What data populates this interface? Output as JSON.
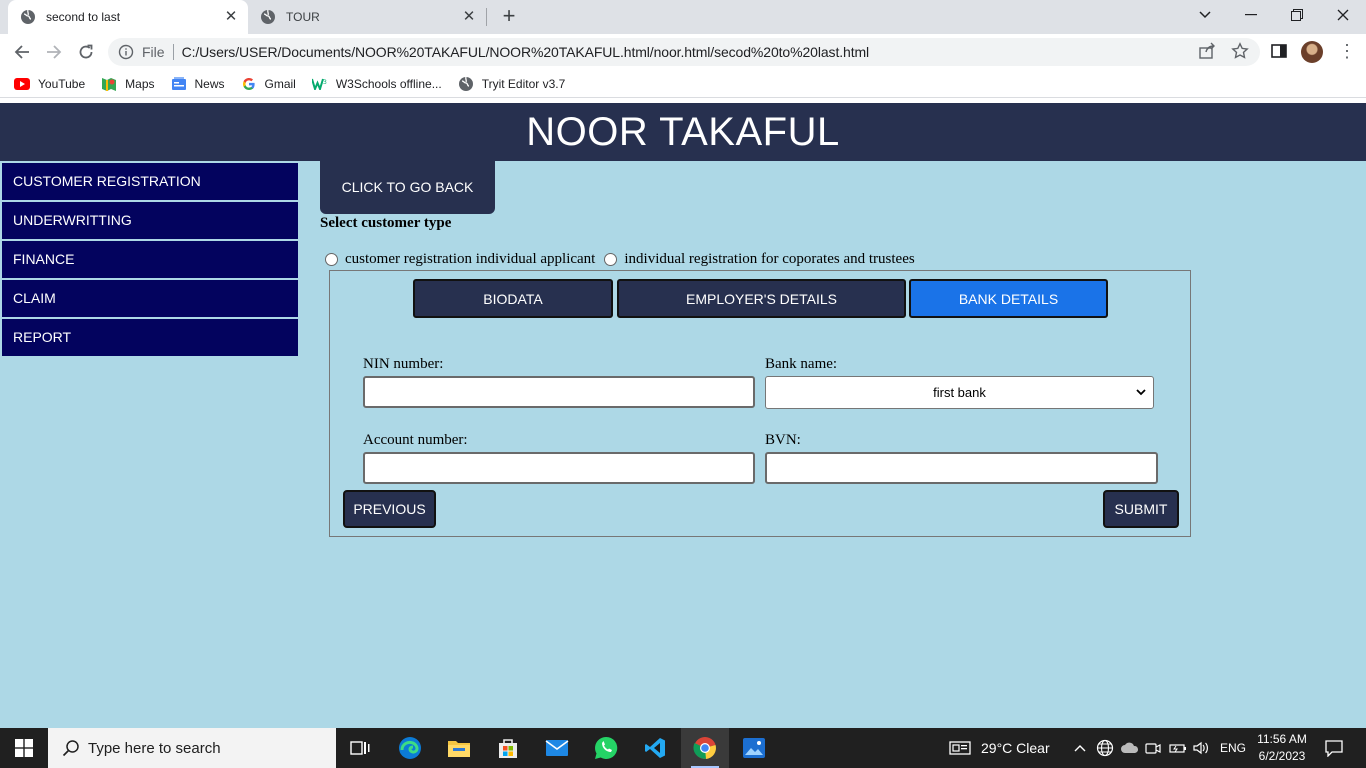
{
  "browser": {
    "tabs": [
      {
        "title": "second to last",
        "active": true
      },
      {
        "title": "TOUR",
        "active": false
      }
    ],
    "address": {
      "scheme": "File",
      "url": "C:/Users/USER/Documents/NOOR%20TAKAFUL/NOOR%20TAKAFUL.html/noor.html/secod%20to%20last.html"
    },
    "bookmarks": [
      {
        "label": "YouTube",
        "icon": "youtube-icon"
      },
      {
        "label": "Maps",
        "icon": "maps-icon"
      },
      {
        "label": "News",
        "icon": "news-icon"
      },
      {
        "label": "Gmail",
        "icon": "google-icon"
      },
      {
        "label": "W3Schools offline...",
        "icon": "w3schools-icon"
      },
      {
        "label": "Tryit Editor v3.7",
        "icon": "globe-icon"
      }
    ]
  },
  "site": {
    "title": "NOOR TAKAFUL",
    "menu": [
      "CUSTOMER REGISTRATION",
      "UNDERWRITTING",
      "FINANCE",
      "CLAIM",
      "REPORT"
    ],
    "back_button": "CLICK TO GO BACK",
    "customer_type_label": "Select customer type",
    "radio_options": [
      "customer registration individual applicant",
      "individual registration for coporates and trustees"
    ],
    "form_tabs": [
      "BIODATA",
      "EMPLOYER'S DETAILS",
      "BANK DETAILS"
    ],
    "active_tab": "BANK DETAILS",
    "fields": {
      "nin_label": "NIN number:",
      "nin_value": "",
      "bank_label": "Bank name:",
      "bank_value": "first bank",
      "account_label": "Account number:",
      "account_value": "",
      "bvn_label": "BVN:",
      "bvn_value": ""
    },
    "previous_button": "PREVIOUS",
    "submit_button": "SUBMIT"
  },
  "taskbar": {
    "search_placeholder": "Type here to search",
    "weather": "29°C  Clear",
    "language": "ENG",
    "time": "11:56 AM",
    "date": "6/2/2023"
  },
  "colors": {
    "page_bg": "#add8e6",
    "header_bg": "#27304f",
    "menu_bg": "#03035e",
    "active_tab": "#1a73e8"
  }
}
